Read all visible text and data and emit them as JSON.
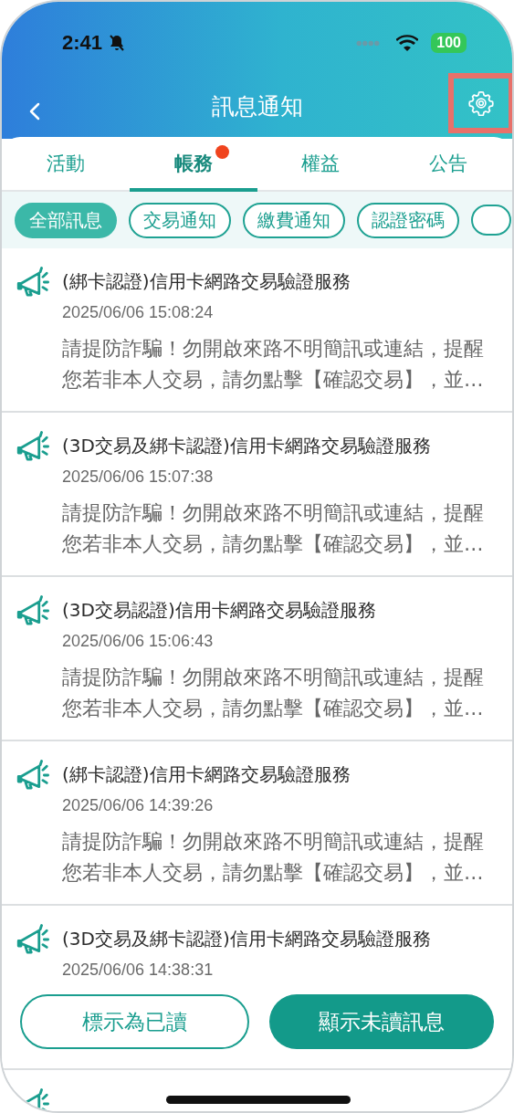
{
  "status_bar": {
    "time": "2:41",
    "battery": "100"
  },
  "nav": {
    "title": "訊息通知"
  },
  "tabs": [
    {
      "label": "活動",
      "selected": false,
      "badge": false
    },
    {
      "label": "帳務",
      "selected": true,
      "badge": true
    },
    {
      "label": "權益",
      "selected": false,
      "badge": false
    },
    {
      "label": "公告",
      "selected": false,
      "badge": false
    }
  ],
  "filters": [
    {
      "label": "全部訊息",
      "selected": true
    },
    {
      "label": "交易通知",
      "selected": false
    },
    {
      "label": "繳費通知",
      "selected": false
    },
    {
      "label": "認證密碼",
      "selected": false
    }
  ],
  "messages": [
    {
      "title": "(綁卡認證)信用卡網路交易驗證服務",
      "time": "2025/06/06 15:08:24",
      "body": "請提防詐騙！勿開啟來路不明簡訊或連結，提醒您若非本人交易，請勿點擊【確認交易】，並…"
    },
    {
      "title": "(3D交易及綁卡認證)信用卡網路交易驗證服務",
      "time": "2025/06/06 15:07:38",
      "body": "請提防詐騙！勿開啟來路不明簡訊或連結，提醒您若非本人交易，請勿點擊【確認交易】，並…"
    },
    {
      "title": "(3D交易認證)信用卡網路交易驗證服務",
      "time": "2025/06/06 15:06:43",
      "body": "請提防詐騙！勿開啟來路不明簡訊或連結，提醒您若非本人交易，請勿點擊【確認交易】，並…"
    },
    {
      "title": "(綁卡認證)信用卡網路交易驗證服務",
      "time": "2025/06/06 14:39:26",
      "body": "請提防詐騙！勿開啟來路不明簡訊或連結，提醒您若非本人交易，請勿點擊【確認交易】，並…"
    },
    {
      "title": "(3D交易及綁卡認證)信用卡網路交易驗證服務",
      "time": "2025/06/06 14:38:31"
    }
  ],
  "actions": [
    {
      "label": "標示為已讀",
      "kind": "outline"
    },
    {
      "label": "顯示未讀訊息",
      "kind": "filled"
    }
  ]
}
